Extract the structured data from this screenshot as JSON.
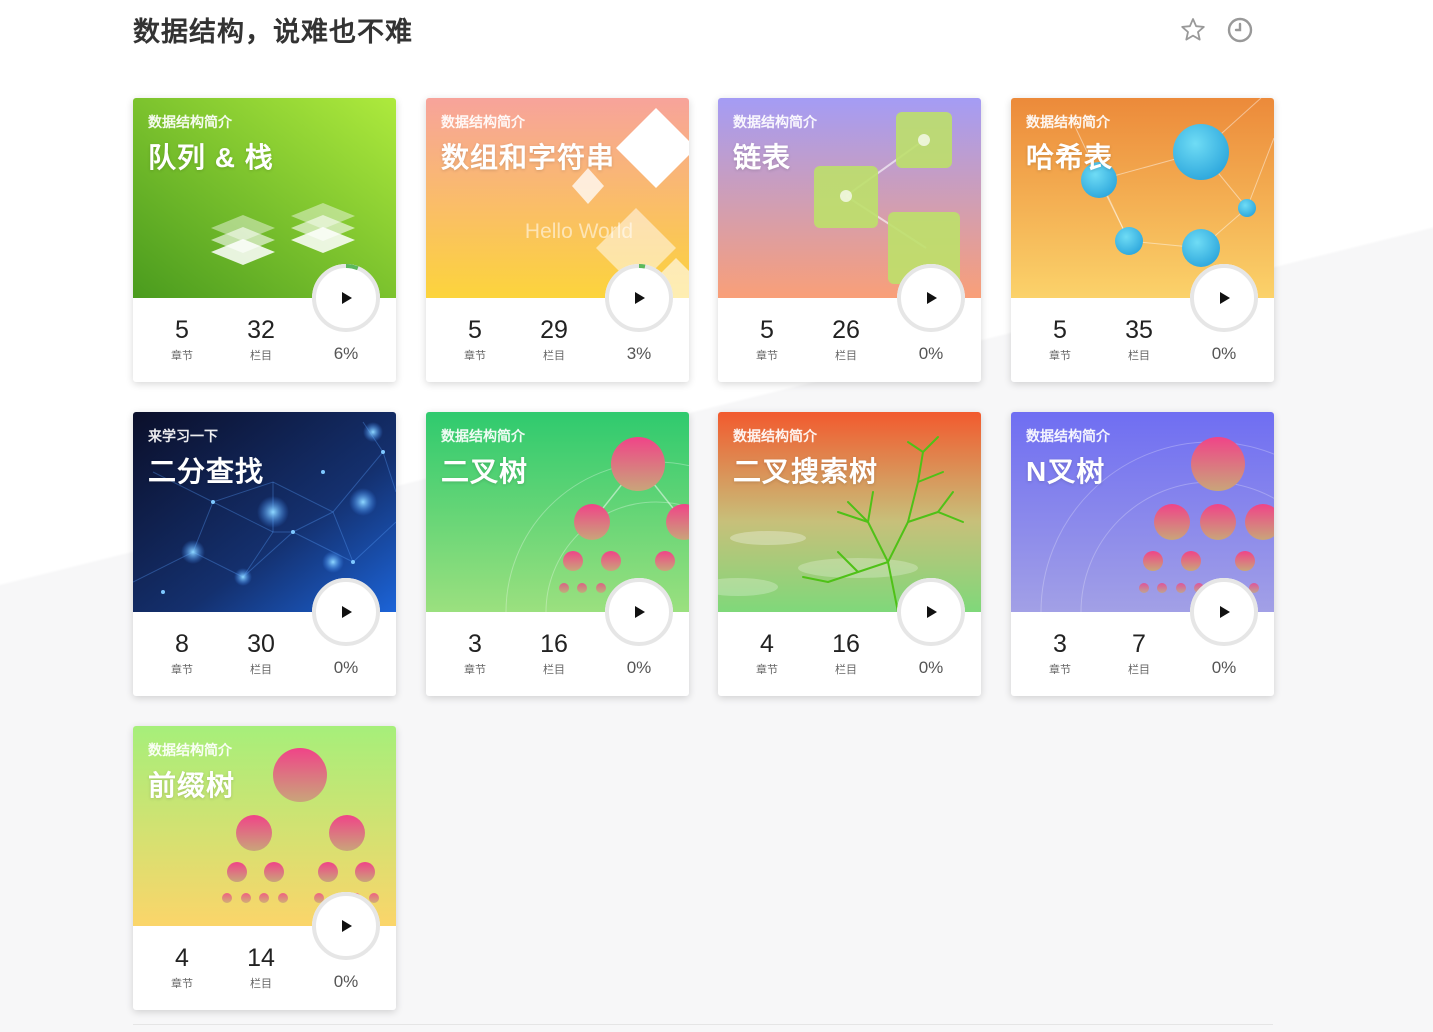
{
  "page": {
    "title": "数据结构，说难也不难",
    "favorite_icon": "star-outline-icon",
    "history_icon": "clock-icon"
  },
  "labels": {
    "chapters": "章节",
    "columns": "栏目"
  },
  "cards": [
    {
      "subtitle": "数据结构简介",
      "title": "队列 & 栈",
      "chapters": "5",
      "columns": "32",
      "progress": "6%",
      "progress_value": 0.06,
      "theme": "green"
    },
    {
      "subtitle": "数据结构简介",
      "title": "数组和字符串",
      "chapters": "5",
      "columns": "29",
      "progress": "3%",
      "progress_value": 0.03,
      "theme": "orange-pink",
      "cover_text": "Hello World"
    },
    {
      "subtitle": "数据结构简介",
      "title": "链表",
      "chapters": "5",
      "columns": "26",
      "progress": "0%",
      "progress_value": 0,
      "theme": "purple-peach"
    },
    {
      "subtitle": "数据结构简介",
      "title": "哈希表",
      "chapters": "5",
      "columns": "35",
      "progress": "0%",
      "progress_value": 0,
      "theme": "orange"
    },
    {
      "subtitle": "来学习一下",
      "title": "二分查找",
      "chapters": "8",
      "columns": "30",
      "progress": "0%",
      "progress_value": 0,
      "theme": "dark-blue"
    },
    {
      "subtitle": "数据结构简介",
      "title": "二叉树",
      "chapters": "3",
      "columns": "16",
      "progress": "0%",
      "progress_value": 0,
      "theme": "green-tree"
    },
    {
      "subtitle": "数据结构简介",
      "title": "二叉搜索树",
      "chapters": "4",
      "columns": "16",
      "progress": "0%",
      "progress_value": 0,
      "theme": "red-green"
    },
    {
      "subtitle": "数据结构简介",
      "title": "N叉树",
      "chapters": "3",
      "columns": "7",
      "progress": "0%",
      "progress_value": 0,
      "theme": "indigo"
    },
    {
      "subtitle": "数据结构简介",
      "title": "前缀树",
      "chapters": "4",
      "columns": "14",
      "progress": "0%",
      "progress_value": 0,
      "theme": "lime-yellow"
    }
  ],
  "colors": {
    "progress_ring": "#5cb85c",
    "ring_track": "#e6e6e6",
    "title_text": "#333333"
  }
}
